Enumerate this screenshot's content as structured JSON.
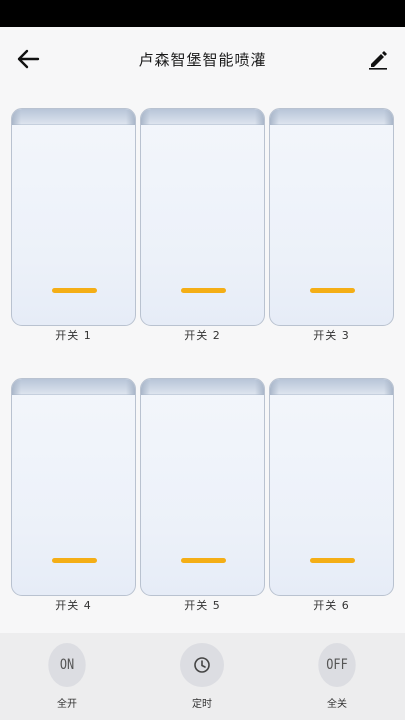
{
  "header": {
    "title": "卢森智堡智能喷灌",
    "back_icon": "arrow-left-icon",
    "edit_icon": "pencil-icon"
  },
  "switches": [
    {
      "label": "开关 1"
    },
    {
      "label": "开关 2"
    },
    {
      "label": "开关 3"
    },
    {
      "label": "开关 4"
    },
    {
      "label": "开关 5"
    },
    {
      "label": "开关 6"
    }
  ],
  "bottom_actions": {
    "all_on": {
      "icon_text": "ON",
      "label": "全开"
    },
    "timer": {
      "icon": "clock-icon",
      "label": "定时"
    },
    "all_off": {
      "icon_text": "OFF",
      "label": "全关"
    }
  },
  "colors": {
    "indicator": "#f4ae16",
    "background": "#f7f7f8",
    "bottom_bar": "#ededee"
  }
}
